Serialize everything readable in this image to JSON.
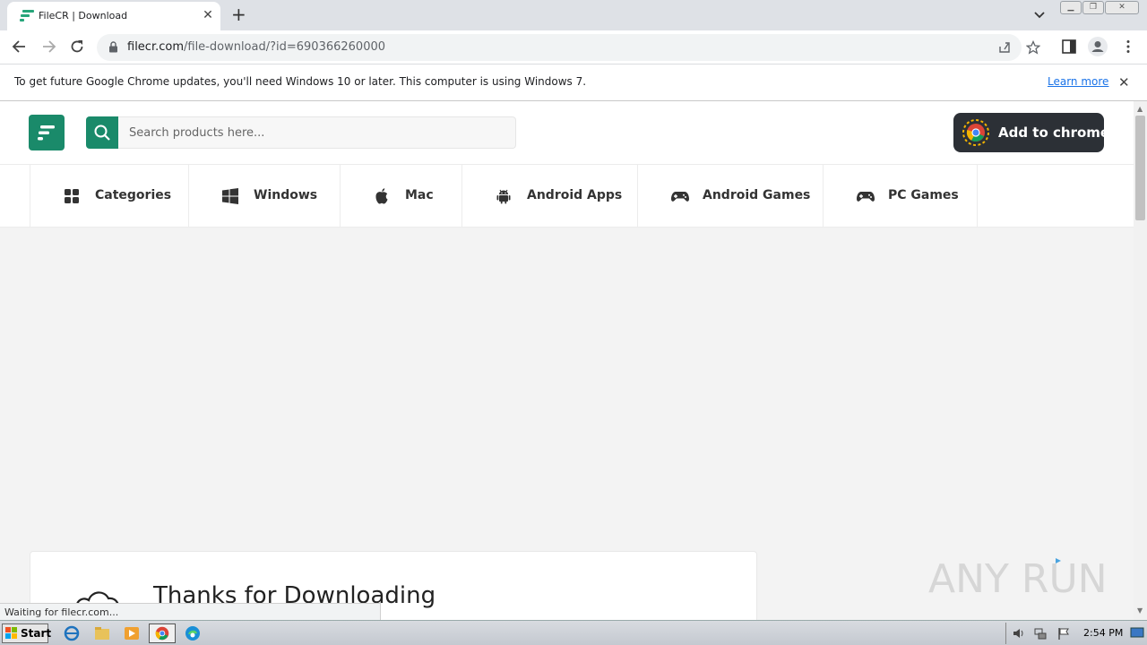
{
  "browser": {
    "tab_title": "FileCR | Download",
    "url_host": "filecr.com",
    "url_path": "/file-download/?id=690366260000"
  },
  "infobar": {
    "message": "To get future Google Chrome updates, you'll need Windows 10 or later. This computer is using Windows 7.",
    "learn_more": "Learn more"
  },
  "site": {
    "search_placeholder": "Search products here...",
    "add_to_chrome": "Add to chrome",
    "nav": [
      {
        "label": "Categories",
        "icon": "grid-icon"
      },
      {
        "label": "Windows",
        "icon": "windows-icon"
      },
      {
        "label": "Mac",
        "icon": "apple-icon"
      },
      {
        "label": "Android Apps",
        "icon": "android-icon"
      },
      {
        "label": "Android Games",
        "icon": "gamepad-icon"
      },
      {
        "label": "PC Games",
        "icon": "gamepad-icon"
      }
    ],
    "thanks_title": "Thanks for Downloading",
    "brand_color": "#1a8a6a"
  },
  "status": {
    "text": "Waiting for filecr.com..."
  },
  "watermark": {
    "text": "ANY RUN"
  },
  "taskbar": {
    "start_label": "Start",
    "clock": "2:54 PM"
  }
}
